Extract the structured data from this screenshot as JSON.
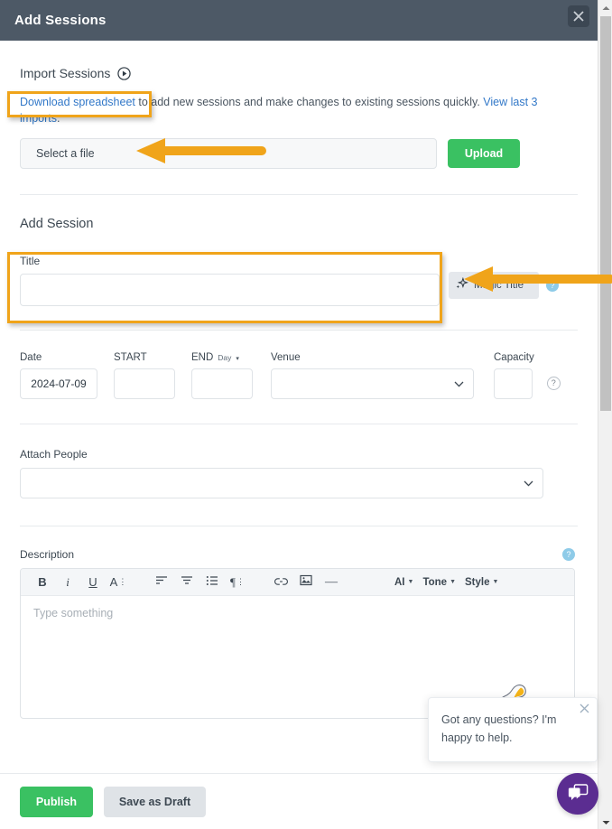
{
  "modal": {
    "title": "Add Sessions",
    "close_icon": "close-icon"
  },
  "import": {
    "heading": "Import Sessions",
    "play_icon": "play-circle-icon",
    "desc_link": "Download spreadsheet",
    "desc_mid": " to add new sessions and make changes to existing sessions quickly. ",
    "desc_link2": "View last 3 imports",
    "desc_end": ".",
    "file_placeholder": "Select a file",
    "upload_label": "Upload"
  },
  "add_session": {
    "heading": "Add Session",
    "title_label": "Title",
    "title_value": "",
    "title_placeholder": "",
    "magic_title_label": "Magic Title",
    "magic_icon": "sparkle-icon",
    "magic_help": "?",
    "date_label": "Date",
    "date_value": "2024-07-09",
    "start_label": "START",
    "start_value": "",
    "end_label": "END",
    "end_sub_label": "Day",
    "end_value": "",
    "venue_label": "Venue",
    "venue_value": "",
    "capacity_label": "Capacity",
    "capacity_value": "",
    "capacity_help": "?",
    "attach_label": "Attach People",
    "attach_value": ""
  },
  "description": {
    "label": "Description",
    "help": "?",
    "placeholder": "Type something",
    "toolbar": {
      "bold": "B",
      "italic": "i",
      "underline": "U",
      "font_size": "A",
      "align_left": "align-left-icon",
      "align_center": "align-center-icon",
      "list": "list-icon",
      "paragraph": "¶",
      "link": "link-icon",
      "image": "image-icon",
      "divider": "—",
      "ai_label": "AI",
      "tone_label": "Tone",
      "style_label": "Style"
    }
  },
  "footer": {
    "publish_label": "Publish",
    "draft_label": "Save as Draft"
  },
  "chat": {
    "message": "Got any questions? I'm happy to help.",
    "close_icon": "close-icon",
    "mascot_icon": "mascot-icon",
    "fab_icon": "chat-bubble-icon"
  },
  "scrollbar": {
    "up_icon": "caret-up-icon",
    "down_icon": "caret-down-icon"
  },
  "colors": {
    "header_bg": "#4d5966",
    "accent_green": "#3ac162",
    "link_blue": "#3278c8",
    "annotation_orange": "#f0a41a",
    "chat_purple": "#5b2d91",
    "help_blue": "#8ecbe8"
  }
}
